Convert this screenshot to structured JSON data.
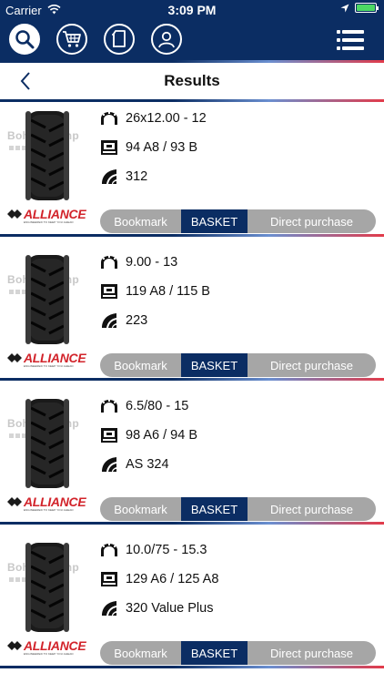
{
  "status": {
    "carrier": "Carrier",
    "time": "3:09 PM"
  },
  "header": {
    "title": "Results"
  },
  "watermark": "Bohnenkamp",
  "brand": {
    "name": "ALLIANCE",
    "tagline": "ENGINEERED TO KEEP YOU AHEAD"
  },
  "buttons": {
    "bookmark": "Bookmark",
    "basket": "BASKET",
    "direct": "Direct purchase"
  },
  "results": [
    {
      "size": "26x12.00 - 12",
      "load": "94 A8 / 93 B",
      "pattern": "312"
    },
    {
      "size": "9.00 - 13",
      "load": "119 A8 / 115 B",
      "pattern": "223"
    },
    {
      "size": "6.5/80 - 15",
      "load": "98 A6 / 94 B",
      "pattern": "AS 324"
    },
    {
      "size": "10.0/75 - 15.3",
      "load": "129 A6 / 125 A8",
      "pattern": "320 Value Plus"
    }
  ],
  "colors": {
    "navy": "#0b2d63",
    "gray": "#a6a6a6",
    "brand_red": "#d2232a",
    "battery_green": "#4cd964"
  }
}
